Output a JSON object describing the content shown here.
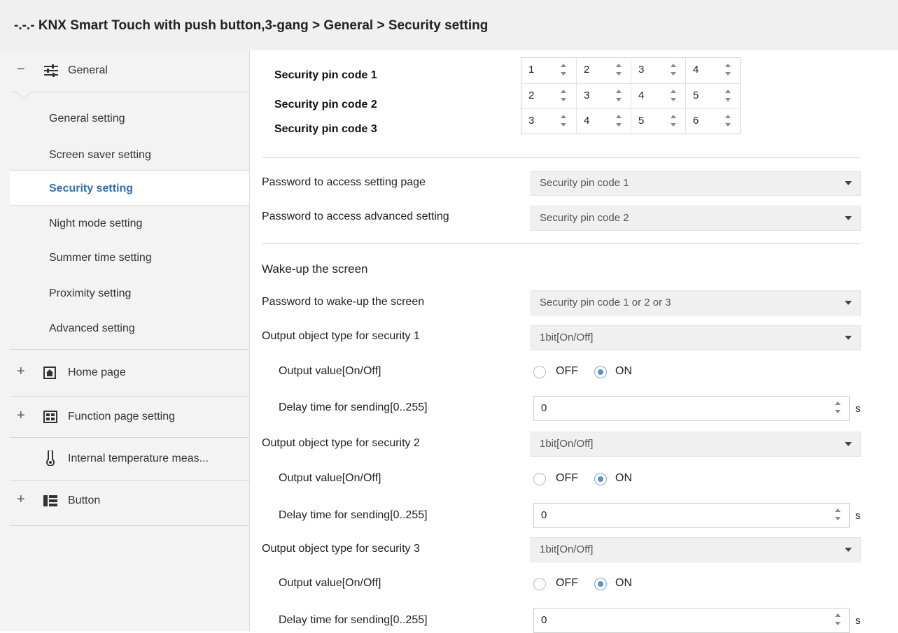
{
  "title": "-.-.- KNX Smart Touch with push button,3-gang > General > Security setting",
  "sidebar": {
    "general": {
      "sign": "−",
      "label": "General",
      "icon": "sliders-icon"
    },
    "subitems": [
      "General setting",
      "Screen saver setting",
      "Security setting",
      "Night mode setting",
      "Summer time setting",
      "Proximity setting",
      "Advanced setting"
    ],
    "selected_index": 2,
    "groups": [
      {
        "sign": "+",
        "label": "Home page",
        "icon": "home-icon"
      },
      {
        "sign": "+",
        "label": "Function page setting",
        "icon": "grid-icon"
      },
      {
        "sign": "",
        "label": "Internal temperature meas...",
        "icon": "thermometer-icon"
      },
      {
        "sign": "+",
        "label": "Button",
        "icon": "button-list-icon"
      }
    ]
  },
  "pins": [
    {
      "label": "Security pin code 1",
      "digits": [
        "1",
        "2",
        "3",
        "4"
      ]
    },
    {
      "label": "Security pin code 2",
      "digits": [
        "2",
        "3",
        "4",
        "5"
      ]
    },
    {
      "label": "Security pin code 3",
      "digits": [
        "3",
        "4",
        "5",
        "6"
      ]
    }
  ],
  "access": [
    {
      "label": "Password to access setting page",
      "value": "Security pin code 1"
    },
    {
      "label": "Password to access advanced setting",
      "value": "Security pin code 2"
    }
  ],
  "wake": {
    "heading": "Wake-up the screen",
    "password_label": "Password to wake-up the screen",
    "password_value": "Security pin code 1 or 2 or 3"
  },
  "outputs": [
    {
      "type_label": "Output object type for security 1",
      "type_value": "1bit[On/Off]",
      "value_label": "Output value[On/Off]",
      "off": "OFF",
      "on": "ON",
      "selected": "ON",
      "delay_label": "Delay time for sending[0..255]",
      "delay_value": "0",
      "unit": "s"
    },
    {
      "type_label": "Output object type for security 2",
      "type_value": "1bit[On/Off]",
      "value_label": "Output value[On/Off]",
      "off": "OFF",
      "on": "ON",
      "selected": "ON",
      "delay_label": "Delay time for sending[0..255]",
      "delay_value": "0",
      "unit": "s"
    },
    {
      "type_label": "Output object type for security 3",
      "type_value": "1bit[On/Off]",
      "value_label": "Output value[On/Off]",
      "off": "OFF",
      "on": "ON",
      "selected": "ON",
      "delay_label": "Delay time for sending[0..255]",
      "delay_value": "0",
      "unit": "s"
    }
  ]
}
